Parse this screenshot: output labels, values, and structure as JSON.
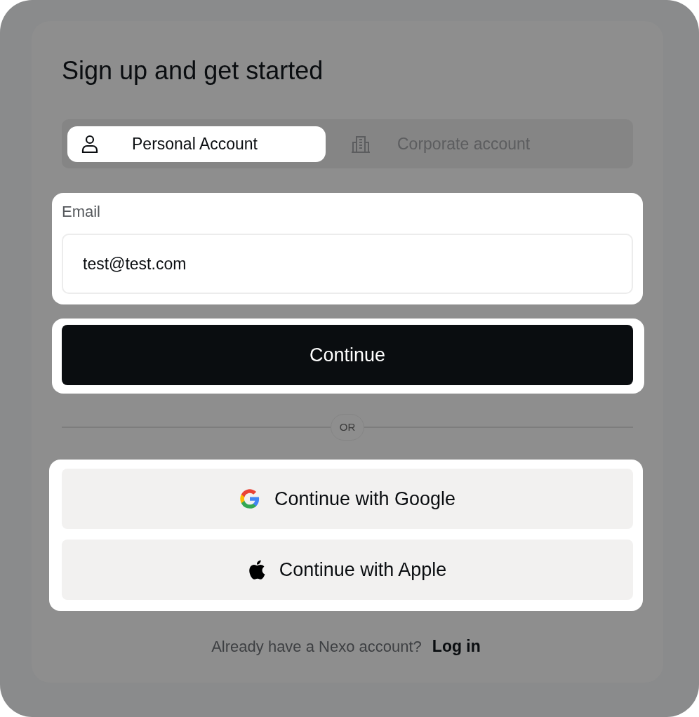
{
  "title": "Sign up and get started",
  "tabs": [
    {
      "label": "Personal Account",
      "kind": "person",
      "selected": true
    },
    {
      "label": "Corporate account",
      "kind": "building",
      "selected": false
    }
  ],
  "email": {
    "label": "Email",
    "value": "test@test.com"
  },
  "continue_button": "Continue",
  "divider": "OR",
  "social_buttons": [
    {
      "label": "Continue with Google",
      "kind": "google"
    },
    {
      "label": "Continue with Apple",
      "kind": "apple"
    }
  ],
  "footer": {
    "text": "Already have a Nexo account?",
    "link": "Log in"
  }
}
